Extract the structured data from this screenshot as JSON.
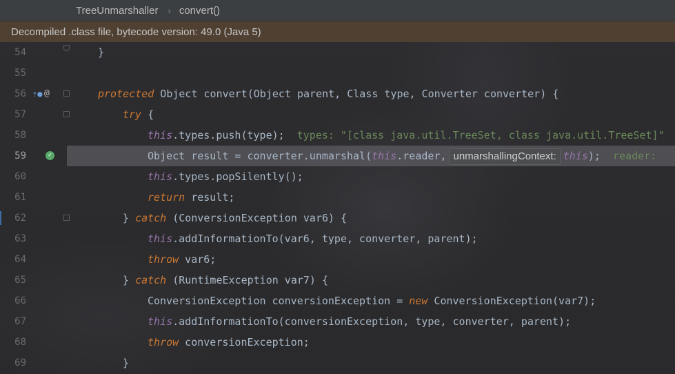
{
  "breadcrumb": {
    "class_name": "TreeUnmarshaller",
    "separator": "›",
    "method": "convert()"
  },
  "banner": {
    "text": "Decompiled .class file, bytecode version: 49.0 (Java 5)"
  },
  "gutter_icons": {
    "line56_override": "override-breakpoint-icon",
    "line56_annotation": "@",
    "line59_execution": "execution-point-check-icon"
  },
  "colors": {
    "keyword": "#cc7832",
    "field": "#9876aa",
    "default_text": "#a9b7c6",
    "string": "#6a8759",
    "banner_bg": "#4f4032",
    "current_line_bg": "#6b6b72"
  },
  "lines": [
    {
      "num": "54",
      "t": [
        "}"
      ]
    },
    {
      "num": "55",
      "t": []
    },
    {
      "num": "56",
      "t": [
        "protected",
        " Object convert(Object parent, Class type, Converter converter) {"
      ]
    },
    {
      "num": "57",
      "t": [
        "try",
        " {"
      ]
    },
    {
      "num": "58",
      "t": [
        "this",
        ".types.push(type);",
        "types: ",
        "\"[class java.util.TreeSet, class java.util.TreeSet]\""
      ]
    },
    {
      "num": "59",
      "t": [
        "Object result = converter.unmarshal(",
        "this",
        ".reader,",
        "unmarshallingContext:",
        "this",
        ");",
        "reader:"
      ]
    },
    {
      "num": "60",
      "t": [
        "this",
        ".types.popSilently();"
      ]
    },
    {
      "num": "61",
      "t": [
        "return",
        " result;"
      ]
    },
    {
      "num": "62",
      "t": [
        "} ",
        "catch",
        " (ConversionException var6) {"
      ]
    },
    {
      "num": "63",
      "t": [
        "this",
        ".addInformationTo(var6, type, converter, parent);"
      ]
    },
    {
      "num": "64",
      "t": [
        "throw",
        " var6;"
      ]
    },
    {
      "num": "65",
      "t": [
        "} ",
        "catch",
        " (RuntimeException var7) {"
      ]
    },
    {
      "num": "66",
      "t": [
        "ConversionException conversionException = ",
        "new",
        " ConversionException(var7);"
      ]
    },
    {
      "num": "67",
      "t": [
        "this",
        ".addInformationTo(conversionException, type, converter, parent);"
      ]
    },
    {
      "num": "68",
      "t": [
        "throw",
        " conversionException;"
      ]
    },
    {
      "num": "69",
      "t": [
        "}"
      ]
    }
  ]
}
